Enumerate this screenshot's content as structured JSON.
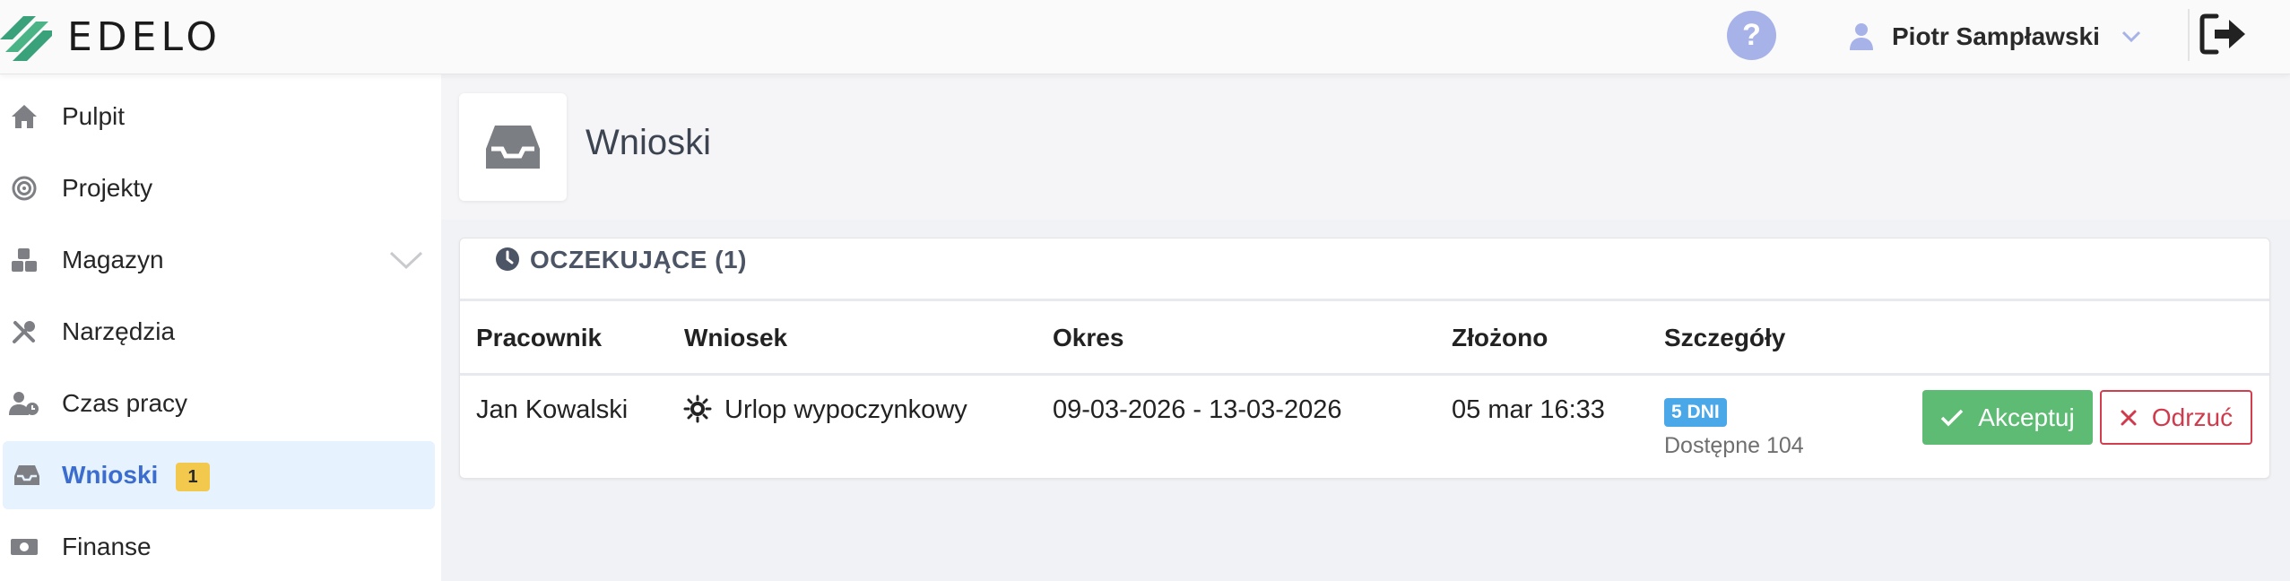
{
  "app": {
    "logo_text": "EDELO"
  },
  "header": {
    "help_label": "?",
    "user_name": "Piotr Sampławski"
  },
  "sidebar": {
    "items": [
      {
        "label": "Pulpit",
        "icon": "home-icon"
      },
      {
        "label": "Projekty",
        "icon": "target-icon"
      },
      {
        "label": "Magazyn",
        "icon": "boxes-icon",
        "expandable": true
      },
      {
        "label": "Narzędzia",
        "icon": "tools-icon"
      },
      {
        "label": "Czas pracy",
        "icon": "user-clock-icon"
      },
      {
        "label": "Wnioski",
        "icon": "inbox-icon",
        "active": true,
        "badge": "1"
      },
      {
        "label": "Finanse",
        "icon": "money-icon"
      }
    ]
  },
  "page": {
    "title": "Wnioski"
  },
  "pending": {
    "title": "OCZEKUJĄCE (1)",
    "columns": [
      "Pracownik",
      "Wniosek",
      "Okres",
      "Złożono",
      "Szczegóły"
    ],
    "rows": [
      {
        "employee": "Jan Kowalski",
        "request_type": "Urlop wypoczynkowy",
        "period": "09-03-2026 - 13-03-2026",
        "submitted": "05 mar 16:33",
        "days_badge": "5 DNI",
        "available": "Dostępne 104",
        "accept_label": "Akceptuj",
        "reject_label": "Odrzuć"
      }
    ]
  },
  "colors": {
    "accent": "#3b6ccf",
    "active_bg": "#e6f2fd",
    "badge": "#f2c94c",
    "accept": "#5dbb73",
    "reject": "#d33e4f",
    "days_badge": "#4aa7e8",
    "help": "#a7b2e9"
  }
}
